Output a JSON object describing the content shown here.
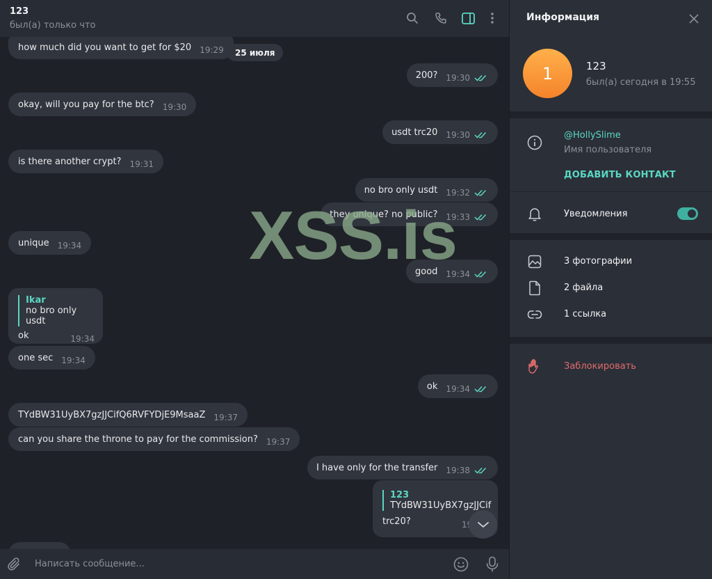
{
  "chat": {
    "title": "123",
    "status": "был(а) только что",
    "date_pill": "25 июля",
    "composer_placeholder": "Написать сообщение...",
    "header_icons": [
      "search-icon",
      "phone-icon",
      "sidebar-toggle-icon",
      "more-icon"
    ],
    "messages": [
      {
        "dir": "in",
        "text": "how much did you want to get for $20",
        "time": "19:29"
      },
      {
        "dir": "out",
        "text": "200?",
        "time": "19:30"
      },
      {
        "dir": "in",
        "text": "okay, will you pay for the btc?",
        "time": "19:30"
      },
      {
        "dir": "out",
        "text": "usdt trc20",
        "time": "19:30"
      },
      {
        "dir": "in",
        "text": "is there another crypt?",
        "time": "19:31"
      },
      {
        "dir": "out",
        "text": "no bro only usdt",
        "time": "19:32"
      },
      {
        "dir": "out",
        "text": "they unique? no public?",
        "time": "19:33"
      },
      {
        "dir": "in",
        "text": "unique",
        "time": "19:34"
      },
      {
        "dir": "out",
        "text": "good",
        "time": "19:34"
      },
      {
        "dir": "in",
        "text": "ok",
        "time": "19:34",
        "reply_name": "Ikar",
        "reply_text": "no bro only usdt"
      },
      {
        "dir": "in",
        "text": "one sec",
        "time": "19:34"
      },
      {
        "dir": "out",
        "text": "ok",
        "time": "19:34"
      },
      {
        "dir": "in",
        "text": "TYdBW31UyBX7gzJJCifQ6RVFYDjE9MsaaZ",
        "time": "19:37"
      },
      {
        "dir": "in",
        "text": "can you share the throne to pay for the commission?",
        "time": "19:37"
      },
      {
        "dir": "out",
        "text": "I have only for the transfer",
        "time": "19:38"
      },
      {
        "dir": "out",
        "text": "trc20?",
        "time": "19:3",
        "reply_name": "123",
        "reply_text": "TYdBW31UyBX7gzJJCif"
      }
    ]
  },
  "watermark": "XSS.is",
  "info": {
    "title": "Информация",
    "avatar_letter": "1",
    "name": "123",
    "seen": "был(а) сегодня в 19:55",
    "username": "@HollySlime",
    "username_label": "Имя пользователя",
    "add_contact": "ДОБАВИТЬ КОНТАКТ",
    "notifications_label": "Уведомления",
    "notifications_on": true,
    "media": [
      {
        "icon": "photo-icon",
        "label": "3 фотографии"
      },
      {
        "icon": "file-icon",
        "label": "2 файла"
      },
      {
        "icon": "link-icon",
        "label": "1 ссылка"
      }
    ],
    "block_label": "Заблокировать"
  },
  "colors": {
    "accent": "#5bd7c3",
    "danger": "#e06c6c",
    "bubble": "#31353e",
    "background": "#1e2128",
    "panel": "#2b2f38"
  }
}
